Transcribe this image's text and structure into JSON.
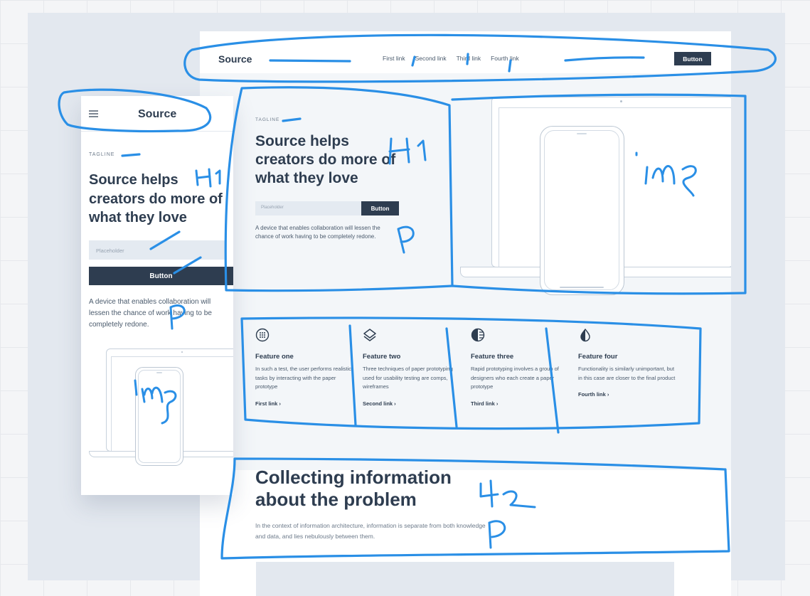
{
  "desktop": {
    "logo": "Source",
    "nav_links": [
      "First link",
      "Second link",
      "Third link",
      "Fourth link"
    ],
    "nav_button": "Button",
    "hero": {
      "tagline": "TAGLINE",
      "heading": "Source helps creators do more of what they love",
      "input_placeholder": "Placeholder",
      "button": "Button",
      "paragraph": "A device that enables collaboration will lessen the chance of work having to be completely redone."
    },
    "features": [
      {
        "icon": "grid-dots-icon",
        "title": "Feature one",
        "text": "In such a test, the user performs realistic tasks by interacting with the paper prototype",
        "link": "First link ›"
      },
      {
        "icon": "layers-icon",
        "title": "Feature two",
        "text": "Three techniques of paper prototyping used for usability testing are comps, wireframes",
        "link": "Second link ›"
      },
      {
        "icon": "half-circle-lines-icon",
        "title": "Feature three",
        "text": "Rapid prototyping involves a group of designers who each create a paper prototype",
        "link": "Third link ›"
      },
      {
        "icon": "half-drop-icon",
        "title": "Feature four",
        "text": "Functionality is similarly unimportant, but in this case are closer to the final product",
        "link": "Fourth link ›"
      }
    ],
    "section2": {
      "heading": "Collecting information about the problem",
      "paragraph": "In the context of information architecture, information is separate from both knowledge and data, and lies nebulously between them."
    }
  },
  "mobile": {
    "logo": "Source",
    "tagline": "TAGLINE",
    "heading": "Source helps creators do more of what they love",
    "input_placeholder": "Placeholder",
    "button": "Button",
    "paragraph": "A device that enables collaboration will lessen the chance of work having to be completely redone."
  },
  "annotations": {
    "h1_desktop": "H1",
    "img_desktop": "img",
    "p_desktop": "P",
    "h1_mobile": "H1",
    "p_mobile": "P",
    "img_mobile": "img",
    "h2": "H2",
    "p_section": "P"
  },
  "colors": {
    "accent": "#2e3d50",
    "annotation": "#2a8fe6",
    "board": "#e3e8ef"
  }
}
